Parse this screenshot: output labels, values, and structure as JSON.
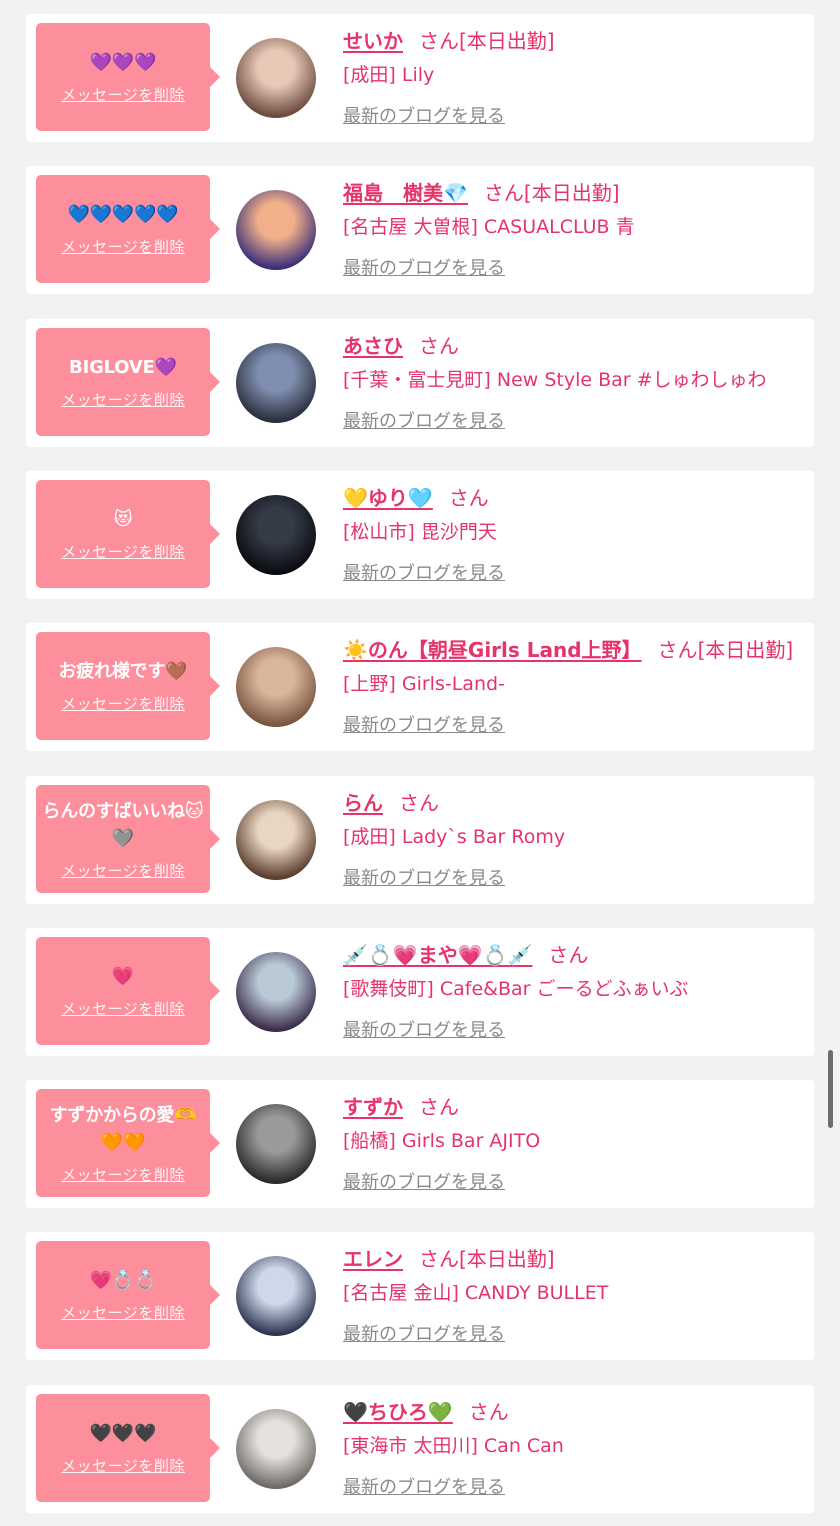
{
  "delete_label": "メッセージを削除",
  "blog_label": "最新のブログを見る",
  "san_label": "さん",
  "colors": {
    "bubble": "#fd8f9c",
    "accent": "#e6336a",
    "muted": "#8a8a8a",
    "bg": "#f2f2f2"
  },
  "items": [
    {
      "message": "💜💜💜",
      "name": "せいか",
      "status": "[本日出勤]",
      "shop": "[成田] Lily",
      "avatar_colors": [
        "#e8c9b8",
        "#6b4b3e"
      ]
    },
    {
      "message": "💙💙💙💙💙",
      "name": "福島　樹美💎",
      "status": "[本日出勤]",
      "shop": "[名古屋 大曽根] CASUALCLUB 青",
      "avatar_colors": [
        "#f2b08a",
        "#3a2f7a"
      ]
    },
    {
      "message": "BIGLOVE💜",
      "name": "あさひ",
      "status": "",
      "shop": "[千葉・富士見町] New Style Bar #しゅわしゅわ",
      "avatar_colors": [
        "#7f8fb0",
        "#2b2f3e"
      ]
    },
    {
      "message": "😻",
      "name": "💛ゆり🩵",
      "status": "",
      "shop": "[松山市] 毘沙門天",
      "avatar_colors": [
        "#343a46",
        "#0a0b10"
      ]
    },
    {
      "message": "お疲れ様です🤎",
      "name": "☀️のん【朝昼Girls Land上野】",
      "status": "[本日出勤]",
      "shop": "[上野] Girls-Land-",
      "avatar_colors": [
        "#d9b79c",
        "#7a5540"
      ]
    },
    {
      "message": "らんのすばいいね🐱🩶",
      "name": "らん",
      "status": "",
      "shop": "[成田] Lady`s Bar Romy",
      "avatar_colors": [
        "#e9d6c2",
        "#5a3e2e"
      ]
    },
    {
      "message": "💗",
      "name": "💉💍💗まや💗💍💉",
      "status": "",
      "shop": "[歌舞伎町] Cafe&Bar ごーるどふぁいぶ",
      "avatar_colors": [
        "#b9c9d6",
        "#3b2d4a"
      ]
    },
    {
      "message": "すずかからの愛🫶🧡🧡",
      "name": "すずか",
      "status": "",
      "shop": "[船橋] Girls Bar AJITO",
      "avatar_colors": [
        "#9a9a9a",
        "#2a2a2a"
      ]
    },
    {
      "message": "💗💍💍",
      "name": "エレン",
      "status": "[本日出勤]",
      "shop": "[名古屋 金山] CANDY BULLET",
      "avatar_colors": [
        "#cfd8ea",
        "#2d3550"
      ]
    },
    {
      "message": "🖤🖤🖤",
      "name": "🖤ちひろ💚",
      "status": "",
      "shop": "[東海市 太田川] Can Can",
      "avatar_colors": [
        "#e5e2de",
        "#6e6a66"
      ]
    }
  ]
}
